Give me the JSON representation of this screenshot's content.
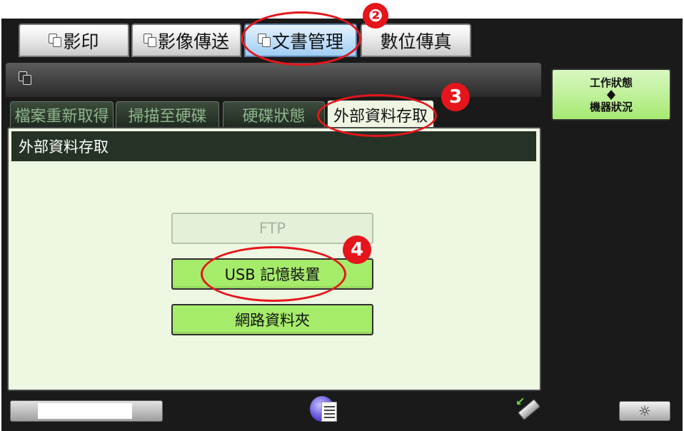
{
  "mode_tabs": [
    {
      "label": "影印"
    },
    {
      "label": "影像傳送"
    },
    {
      "label": "文書管理"
    },
    {
      "label": "數位傳真"
    }
  ],
  "sub_tabs": [
    {
      "label": "檔案重新取得"
    },
    {
      "label": "掃描至硬碟"
    },
    {
      "label": "硬碟狀態"
    },
    {
      "label": "外部資料存取"
    }
  ],
  "section": {
    "title": "外部資料存取"
  },
  "options": {
    "ftp": "FTP",
    "usb": "USB 記憶裝置",
    "network": "網路資料夾"
  },
  "status_button": {
    "line1": "工作狀態",
    "line2": "機器狀況"
  },
  "annotations": {
    "step2": "❷",
    "step3": "3",
    "step4": "4"
  },
  "colors": {
    "highlight": "#e5151b",
    "option_green": "#a6ec6b",
    "panel_bg": "#eef7e2"
  }
}
